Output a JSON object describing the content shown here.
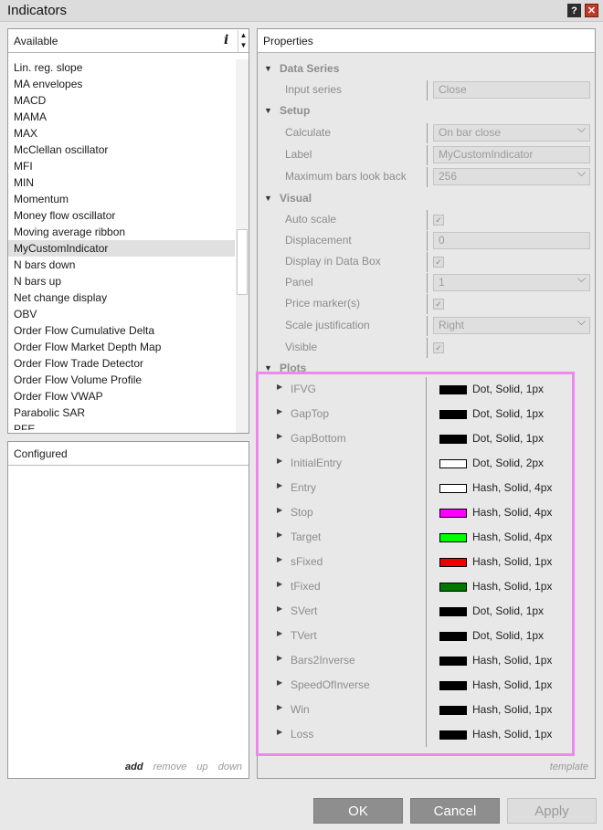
{
  "window": {
    "title": "Indicators",
    "help_label": "?",
    "close_label": "✕"
  },
  "available": {
    "header": "Available",
    "info_icon": "i",
    "items": [
      {
        "label": "Lin. reg. slope"
      },
      {
        "label": "MA envelopes"
      },
      {
        "label": "MACD"
      },
      {
        "label": "MAMA"
      },
      {
        "label": "MAX"
      },
      {
        "label": "McClellan oscillator"
      },
      {
        "label": "MFI"
      },
      {
        "label": "MIN"
      },
      {
        "label": "Momentum"
      },
      {
        "label": "Money flow oscillator"
      },
      {
        "label": "Moving average ribbon"
      },
      {
        "label": "MyCustomIndicator",
        "selected": true
      },
      {
        "label": "N bars down"
      },
      {
        "label": "N bars up"
      },
      {
        "label": "Net change display"
      },
      {
        "label": "OBV"
      },
      {
        "label": "Order Flow Cumulative Delta"
      },
      {
        "label": "Order Flow Market Depth Map"
      },
      {
        "label": "Order Flow Trade Detector"
      },
      {
        "label": "Order Flow Volume Profile"
      },
      {
        "label": "Order Flow VWAP"
      },
      {
        "label": "Parabolic SAR"
      },
      {
        "label": "PFE"
      }
    ]
  },
  "configured": {
    "header": "Configured",
    "actions": {
      "add": "add",
      "remove": "remove",
      "up": "up",
      "down": "down"
    }
  },
  "properties": {
    "header": "Properties",
    "data_series": {
      "title": "Data Series",
      "input_series_label": "Input series",
      "input_series_value": "Close"
    },
    "setup": {
      "title": "Setup",
      "calculate_label": "Calculate",
      "calculate_value": "On bar close",
      "label_label": "Label",
      "label_value": "MyCustomIndicator",
      "max_bars_label": "Maximum bars look back",
      "max_bars_value": "256"
    },
    "visual": {
      "title": "Visual",
      "auto_scale_label": "Auto scale",
      "displacement_label": "Displacement",
      "displacement_value": "0",
      "display_in_databox_label": "Display in Data Box",
      "panel_label": "Panel",
      "panel_value": "1",
      "price_marker_label": "Price marker(s)",
      "scale_just_label": "Scale justification",
      "scale_just_value": "Right",
      "visible_label": "Visible",
      "checkmark": "✓"
    },
    "plots": {
      "title": "Plots",
      "items": [
        {
          "name": "IFVG",
          "color": "#000000",
          "style": "Dot, Solid, 1px"
        },
        {
          "name": "GapTop",
          "color": "#000000",
          "style": "Dot, Solid, 1px"
        },
        {
          "name": "GapBottom",
          "color": "#000000",
          "style": "Dot, Solid, 1px"
        },
        {
          "name": "InitialEntry",
          "color": "#ffffff",
          "style": "Dot, Solid, 2px"
        },
        {
          "name": "Entry",
          "color": "#ffffff",
          "style": "Hash, Solid, 4px"
        },
        {
          "name": "Stop",
          "color": "#ff00ff",
          "style": "Hash, Solid, 4px"
        },
        {
          "name": "Target",
          "color": "#00ff00",
          "style": "Hash, Solid, 4px"
        },
        {
          "name": "sFixed",
          "color": "#ee0000",
          "style": "Hash, Solid, 1px"
        },
        {
          "name": "tFixed",
          "color": "#007700",
          "style": "Hash, Solid, 1px"
        },
        {
          "name": "SVert",
          "color": "#000000",
          "style": "Dot, Solid, 1px"
        },
        {
          "name": "TVert",
          "color": "#000000",
          "style": "Dot, Solid, 1px"
        },
        {
          "name": "Bars2Inverse",
          "color": "#000000",
          "style": "Hash, Solid, 1px"
        },
        {
          "name": "SpeedOfInverse",
          "color": "#000000",
          "style": "Hash, Solid, 1px"
        },
        {
          "name": "Win",
          "color": "#000000",
          "style": "Hash, Solid, 1px"
        },
        {
          "name": "Loss",
          "color": "#000000",
          "style": "Hash, Solid, 1px"
        }
      ]
    },
    "template_link": "template"
  },
  "buttons": {
    "ok": "OK",
    "cancel": "Cancel",
    "apply": "Apply"
  }
}
